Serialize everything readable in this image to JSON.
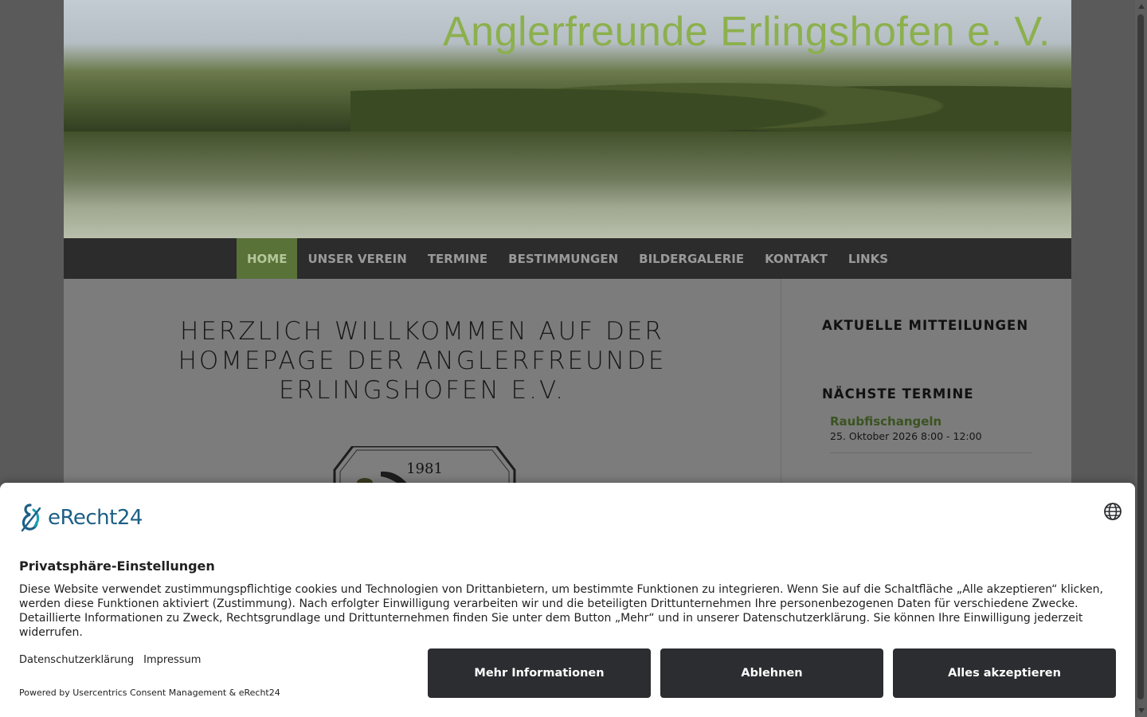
{
  "site": {
    "title": "Anglerfreunde Erlingshofen e. V."
  },
  "nav": {
    "items": [
      {
        "label": "HOME",
        "active": true
      },
      {
        "label": "UNSER VEREIN",
        "active": false
      },
      {
        "label": "TERMINE",
        "active": false
      },
      {
        "label": "BESTIMMUNGEN",
        "active": false
      },
      {
        "label": "BILDERGALERIE",
        "active": false
      },
      {
        "label": "KONTAKT",
        "active": false
      },
      {
        "label": "LINKS",
        "active": false
      }
    ]
  },
  "main": {
    "heading": "HERZLICH WILLKOMMEN AUF DER HOMEPAGE DER ANGLERFREUNDE ERLINGSHOFEN E.V.",
    "logo_year": "1981"
  },
  "sidebar": {
    "news_heading": "AKTUELLE MITTEILUNGEN",
    "events_heading": "NÄCHSTE TERMINE",
    "events": [
      {
        "title": "Raubfischangeln",
        "date": "25. Oktober 2026  8:00 - 12:00"
      }
    ]
  },
  "consent": {
    "brand": "eRecht24",
    "title": "Privatsphäre-Einstellungen",
    "text": "Diese Website verwendet zustimmungspflichtige cookies und Technologien von Drittanbietern, um bestimmte Funktionen zu integrieren. Wenn Sie auf die Schaltfläche „Alle akzeptieren“ klicken, werden diese Funktionen aktiviert (Zustimmung). Nach erfolgter Einwilligung verarbeiten wir und die beteiligten Drittunternehmen Ihre personenbezogenen Daten für verschiedene Zwecke. Detaillierte Informationen zu Zweck, Rechtsgrundlage und Drittunternehmen finden Sie unter dem Button „Mehr“ und in unserer Datenschutzerklärung. Sie können Ihre Einwilligung jederzeit widerrufen.",
    "links": {
      "privacy": "Datenschutzerklärung",
      "imprint": "Impressum"
    },
    "buttons": {
      "more": "Mehr Informationen",
      "deny": "Ablehnen",
      "accept": "Alles akzeptieren"
    },
    "powered": "Powered by Usercentrics Consent Management & eRecht24",
    "icons": {
      "language": "globe-icon",
      "brand_mark": "erecht24-logo-icon"
    }
  },
  "colors": {
    "nav_active": "#597238",
    "title_green": "#8cb04d",
    "button_dark": "#2b2d30",
    "brand_blue": "#1d5f86"
  }
}
